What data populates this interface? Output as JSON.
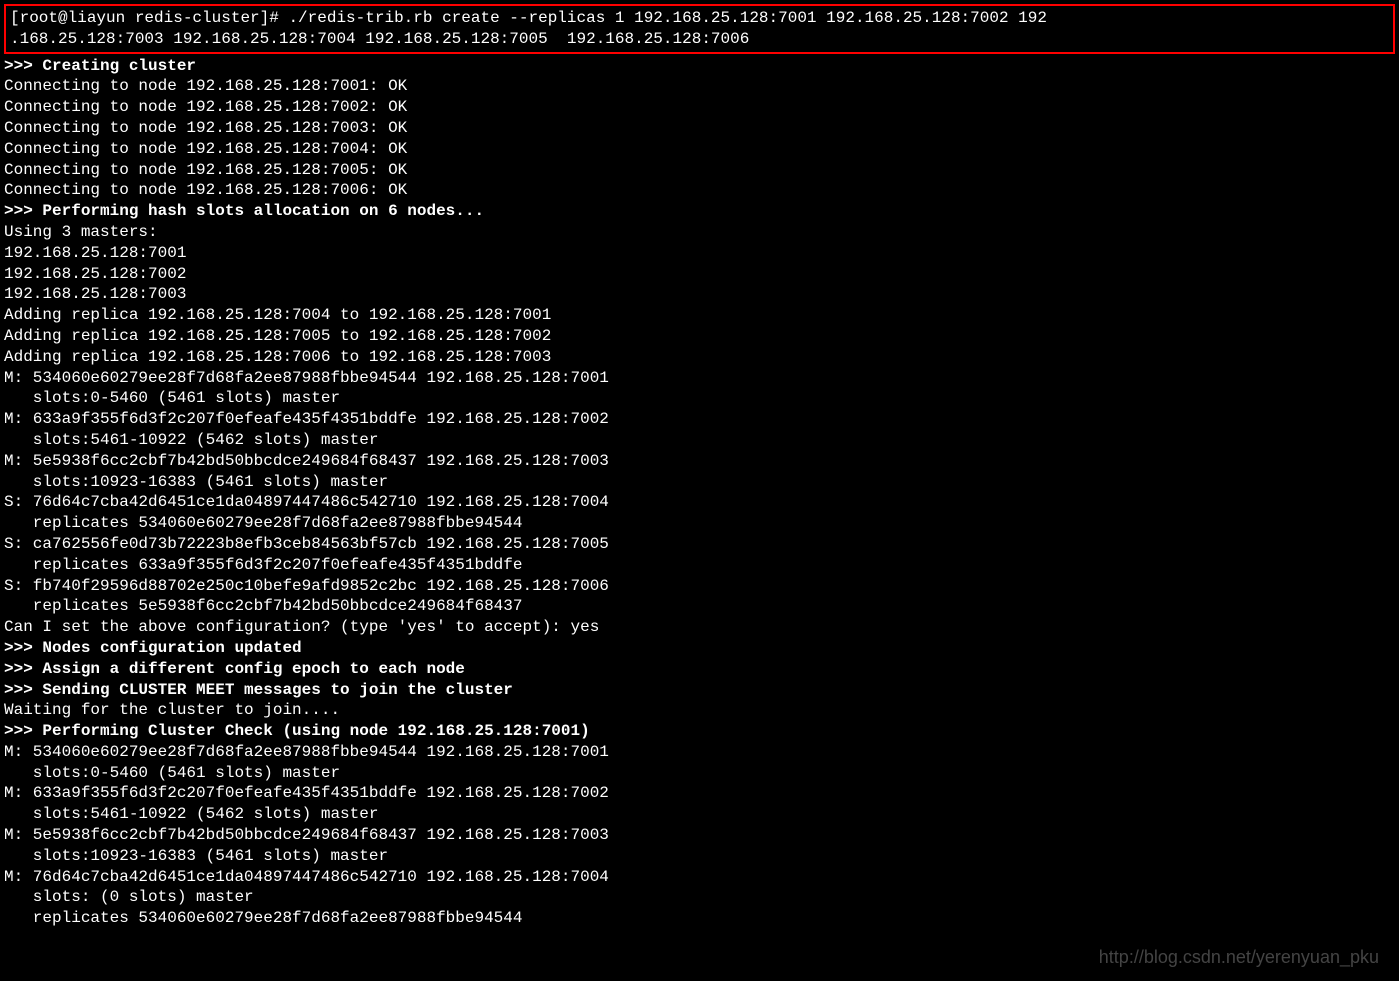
{
  "command_line1": "[root@liayun redis-cluster]# ./redis-trib.rb create --replicas 1 192.168.25.128:7001 192.168.25.128:7002 192",
  "command_line2": ".168.25.128:7003 192.168.25.128:7004 192.168.25.128:7005  192.168.25.128:7006",
  "creating_header": ">>> Creating cluster",
  "connecting": [
    "Connecting to node 192.168.25.128:7001: OK",
    "Connecting to node 192.168.25.128:7002: OK",
    "Connecting to node 192.168.25.128:7003: OK",
    "Connecting to node 192.168.25.128:7004: OK",
    "Connecting to node 192.168.25.128:7005: OK",
    "Connecting to node 192.168.25.128:7006: OK"
  ],
  "hash_slots_header": ">>> Performing hash slots allocation on 6 nodes...",
  "using_masters": "Using 3 masters:",
  "masters": [
    "192.168.25.128:7001",
    "192.168.25.128:7002",
    "192.168.25.128:7003"
  ],
  "adding_replicas": [
    "Adding replica 192.168.25.128:7004 to 192.168.25.128:7001",
    "Adding replica 192.168.25.128:7005 to 192.168.25.128:7002",
    "Adding replica 192.168.25.128:7006 to 192.168.25.128:7003"
  ],
  "nodes_config": [
    "M: 534060e60279ee28f7d68fa2ee87988fbbe94544 192.168.25.128:7001",
    "   slots:0-5460 (5461 slots) master",
    "M: 633a9f355f6d3f2c207f0efeafe435f4351bddfe 192.168.25.128:7002",
    "   slots:5461-10922 (5462 slots) master",
    "M: 5e5938f6cc2cbf7b42bd50bbcdce249684f68437 192.168.25.128:7003",
    "   slots:10923-16383 (5461 slots) master",
    "S: 76d64c7cba42d6451ce1da04897447486c542710 192.168.25.128:7004",
    "   replicates 534060e60279ee28f7d68fa2ee87988fbbe94544",
    "S: ca762556fe0d73b72223b8efb3ceb84563bf57cb 192.168.25.128:7005",
    "   replicates 633a9f355f6d3f2c207f0efeafe435f4351bddfe",
    "S: fb740f29596d88702e250c10befe9afd9852c2bc 192.168.25.128:7006",
    "   replicates 5e5938f6cc2cbf7b42bd50bbcdce249684f68437"
  ],
  "confirm_prompt": "Can I set the above configuration? (type 'yes' to accept): yes",
  "nodes_updated": ">>> Nodes configuration updated",
  "assign_epoch": ">>> Assign a different config epoch to each node",
  "sending_meet": ">>> Sending CLUSTER MEET messages to join the cluster",
  "waiting": "Waiting for the cluster to join....",
  "cluster_check_header": ">>> Performing Cluster Check (using node 192.168.25.128:7001)",
  "check_nodes": [
    "M: 534060e60279ee28f7d68fa2ee87988fbbe94544 192.168.25.128:7001",
    "   slots:0-5460 (5461 slots) master",
    "M: 633a9f355f6d3f2c207f0efeafe435f4351bddfe 192.168.25.128:7002",
    "   slots:5461-10922 (5462 slots) master",
    "M: 5e5938f6cc2cbf7b42bd50bbcdce249684f68437 192.168.25.128:7003",
    "   slots:10923-16383 (5461 slots) master",
    "M: 76d64c7cba42d6451ce1da04897447486c542710 192.168.25.128:7004",
    "   slots: (0 slots) master",
    "   replicates 534060e60279ee28f7d68fa2ee87988fbbe94544"
  ],
  "watermark": "http://blog.csdn.net/yerenyuan_pku"
}
